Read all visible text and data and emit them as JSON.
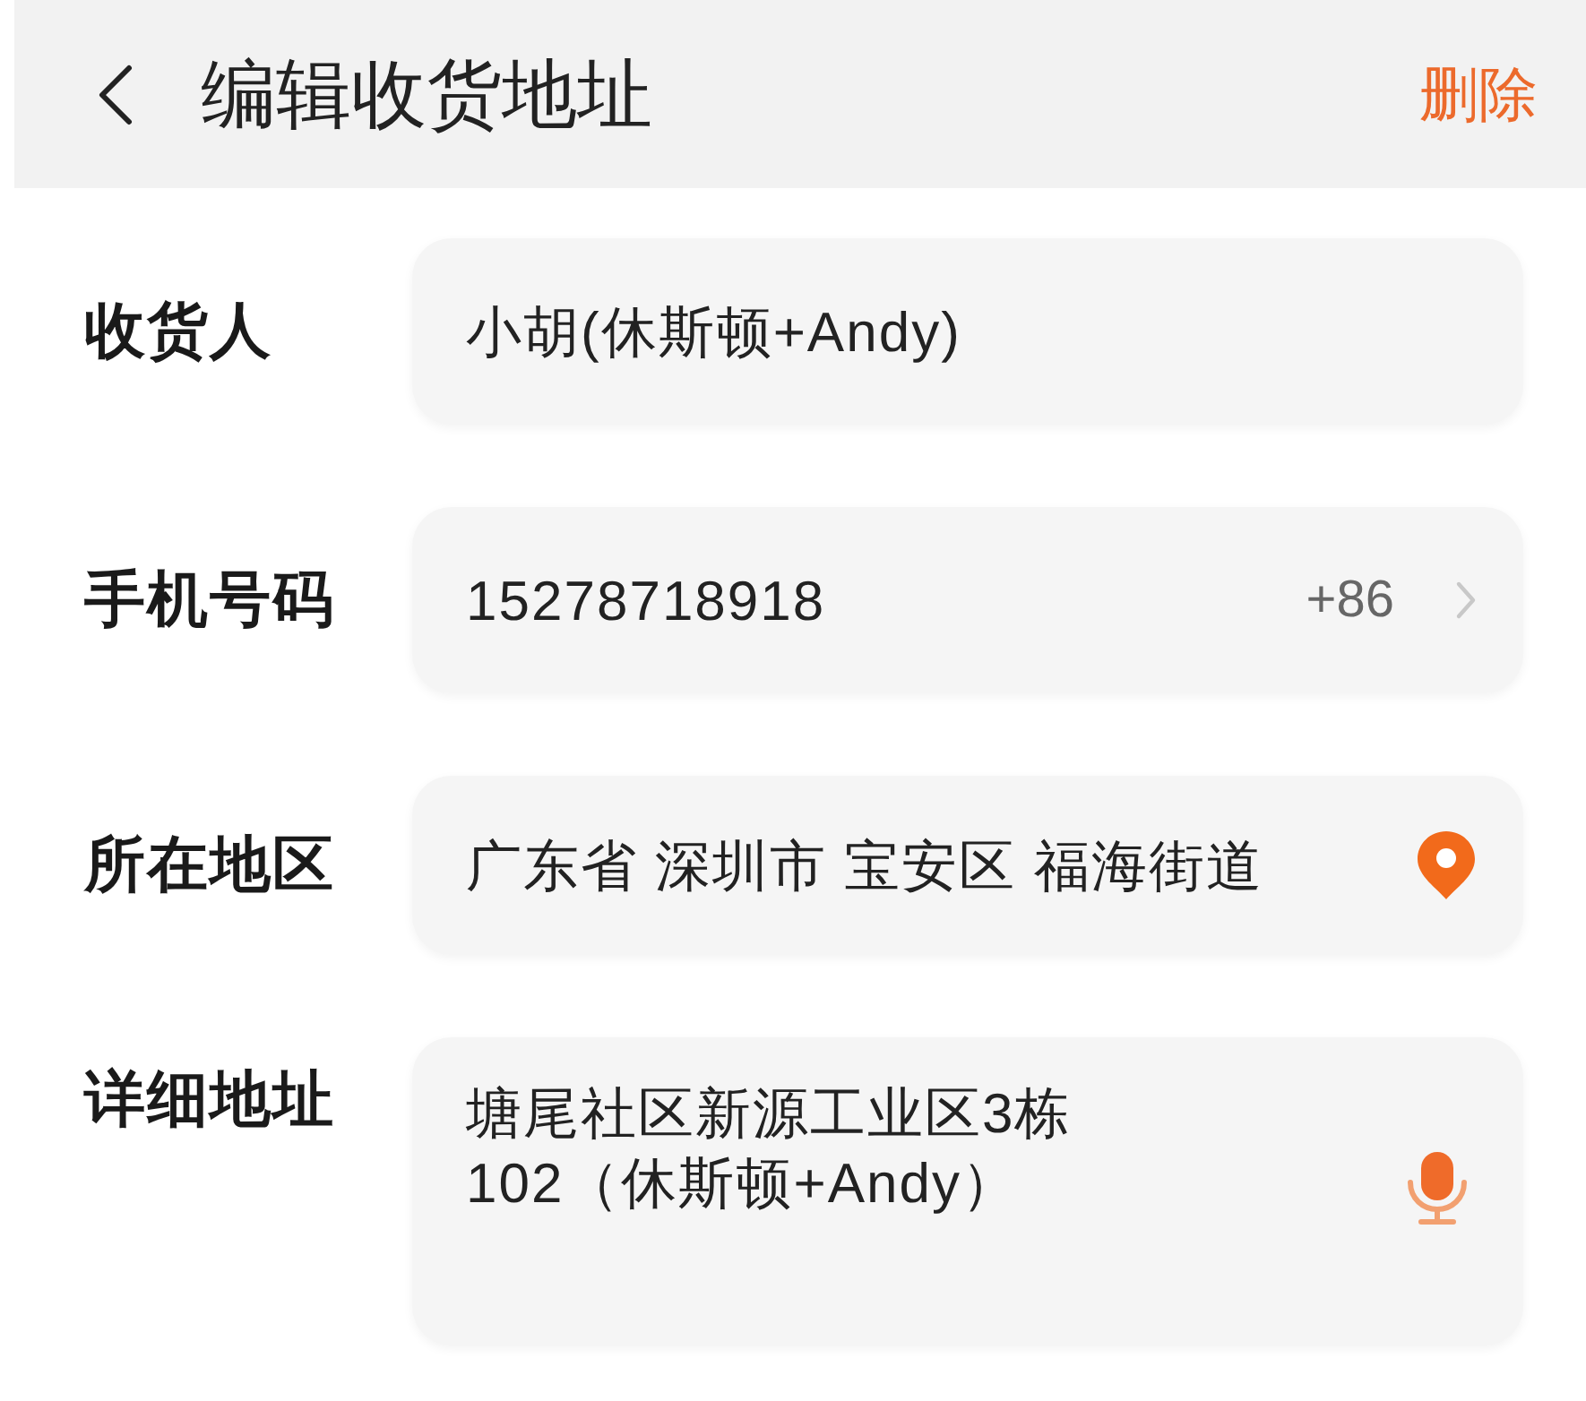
{
  "header": {
    "title": "编辑收货地址",
    "action": "删除"
  },
  "fields": [
    {
      "kind": "text",
      "label": "收货人",
      "value": "小胡(休斯顿+Andy)"
    },
    {
      "kind": "phone",
      "label": "手机号码",
      "value": "15278718918",
      "country_code": "+86"
    },
    {
      "kind": "region",
      "label": "所在地区",
      "value": "广东省 深圳市 宝安区 福海街道"
    },
    {
      "kind": "textarea",
      "label": "详细地址",
      "value": "塘尾社区新源工业区3栋\n102（休斯顿+Andy）"
    }
  ]
}
